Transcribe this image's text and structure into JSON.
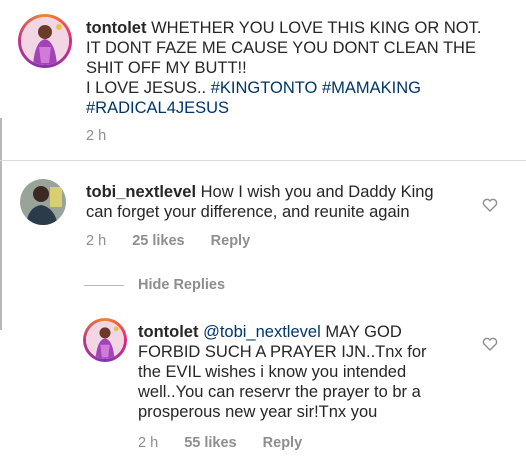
{
  "caption": {
    "username": "tontolet",
    "text_line1": "WHETHER YOU LOVE THIS KING OR NOT.",
    "text_line2": "IT DONT FAZE ME CAUSE YOU DONT CLEAN THE",
    "text_line3": "SHIT OFF MY BUTT!!",
    "line4_prefix": "I LOVE JESUS.. ",
    "hashtag1": "#KINGTONTO",
    "hashtag2": "#MAMAKING",
    "hashtag3": "#RADICAL4JESUS",
    "time": "2 h"
  },
  "comment": {
    "username": "tobi_nextlevel",
    "text_line1": "How I wish you and Daddy King",
    "text_line2": "can forget your difference, and reunite again",
    "time": "2 h",
    "likes": "25 likes",
    "reply_label": "Reply"
  },
  "hide_replies_label": "Hide Replies",
  "reply": {
    "username": "tontolet",
    "mention": "@tobi_nextlevel",
    "text_line1_rest": "MAY GOD",
    "text_line2": "FORBID SUCH A PRAYER IJN..Tnx for",
    "text_line3": "the EVIL wishes i know you intended",
    "text_line4": "well..You can reservr the prayer to br a",
    "text_line5": "prosperous new year sir!Tnx you",
    "time": "2 h",
    "likes": "55 likes",
    "reply_label": "Reply"
  },
  "icons": [
    "heart-icon",
    "avatar"
  ]
}
